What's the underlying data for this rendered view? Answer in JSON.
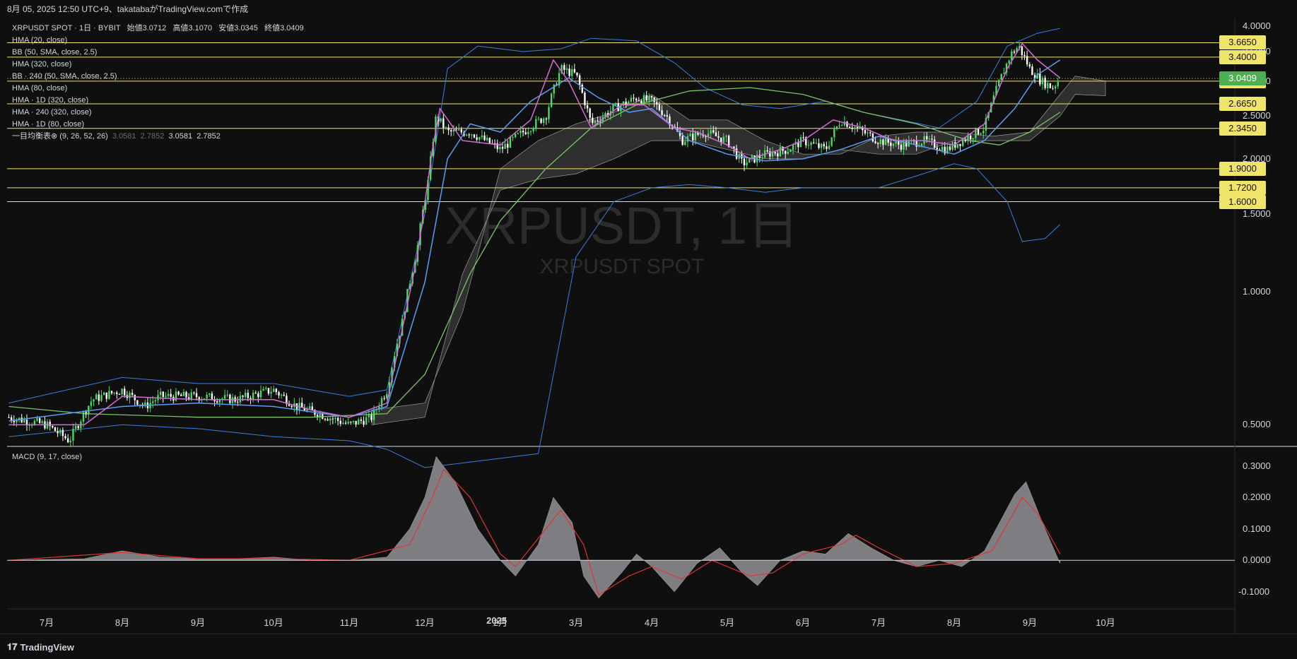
{
  "header": {
    "attribution": "8月 05, 2025 12:50 UTC+9、takatabaがTradingView.comで作成"
  },
  "footer": {
    "brand": "TradingView",
    "brand_icon": "tradingview-logo-icon"
  },
  "legend": {
    "symbol_line": "XRPUSDT SPOT · 1日 · BYBIT",
    "open_label": "始値",
    "open": "3.0712",
    "high_label": "高値",
    "high": "3.1070",
    "low_label": "安値",
    "low": "3.0345",
    "close_label": "終値",
    "close": "3.0409",
    "indicators": [
      "HMA (20, close)",
      "BB (50, SMA, close, 2.5)",
      "HMA (320, close)",
      "BB · 240 (50, SMA, close, 2.5)",
      "HMA (80, close)",
      "HMA · 1D (320, close)",
      "HMA · 240 (320, close)",
      "HMA · 1D (80, close)"
    ],
    "ichimoku_name": "一目均衡表⊗ (9, 26, 52, 26)",
    "ichimoku_dim_values": [
      "3.0581",
      "2.7852"
    ],
    "ichimoku_values": [
      "3.0581",
      "2.7852"
    ],
    "macd_name": "MACD (9, 17, close)"
  },
  "watermark": {
    "large": "XRPUSDT, 1日",
    "small": "XRPUSDT SPOT"
  },
  "colors": {
    "background": "#0f0f0f",
    "candle_up": "#4cd964",
    "candle_down": "#ffffff",
    "hma20": "#d46ad6",
    "hma80": "#5a9cf5",
    "hma320": "#7ac36a",
    "bollinger": "#3b7ddd",
    "ichimoku_cloud": "#4a4a4a",
    "level_line": "#f1e46b",
    "macd_histogram": "#7d7d82",
    "macd_signal": "#e03535",
    "last_price_bg": "#4caf50"
  },
  "chart_data": [
    {
      "type": "line",
      "title": "XRPUSDT SPOT · 1日 · BYBIT",
      "y_scale": "log",
      "ylim": [
        0.45,
        4.1
      ],
      "y_ticks": [
        "4.0000",
        "3.5000",
        "3.0000",
        "2.5000",
        "2.0000",
        "1.5000",
        "1.0000",
        "0.5000"
      ],
      "x_ticks": [
        "7月",
        "8月",
        "9月",
        "10月",
        "11月",
        "12月",
        "2025",
        "2月",
        "3月",
        "4月",
        "5月",
        "6月",
        "7月",
        "8月",
        "9月",
        "10月"
      ],
      "price_levels": [
        "3.6650",
        "3.4000",
        "3.0000",
        "2.6650",
        "2.3450",
        "1.9000",
        "1.7200",
        "1.6000"
      ],
      "last_price": "3.0409",
      "series": [
        {
          "name": "HMA (20, close)",
          "approx_close_by_month": [
            0.47,
            0.58,
            0.55,
            0.52,
            0.51,
            1.2,
            2.1,
            2.8,
            2.3,
            2.0,
            2.2,
            2.1,
            2.4,
            3.4,
            3.05
          ]
        }
      ]
    },
    {
      "type": "bar",
      "title": "MACD (9, 17, close)",
      "y_ticks": [
        "0.3000",
        "0.2000",
        "0.1000",
        "0.0000",
        "-0.1000"
      ],
      "ylim": [
        -0.15,
        0.34
      ]
    }
  ]
}
